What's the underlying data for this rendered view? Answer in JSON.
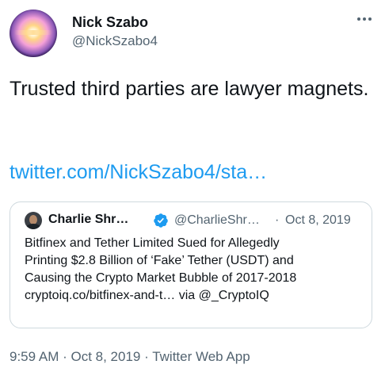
{
  "author": {
    "name": "Nick Szabo",
    "handle": "@NickSzabo4"
  },
  "tweet": {
    "text": "Trusted third parties are lawyer magnets.",
    "link": "twitter.com/NickSzabo4/sta…"
  },
  "quoted": {
    "name": "Charlie Shr…",
    "handle": "@CharlieShr…",
    "dot": "·",
    "date": "Oct 8, 2019",
    "lines": [
      "Bitfinex and Tether Limited Sued for Allegedly",
      "Printing $2.8 Billion of ‘Fake’ Tether (USDT) and",
      "Causing the Crypto Market Bubble of 2017-2018",
      "cryptoiq.co/bitfinex-and-t… via @_CryptoIQ"
    ]
  },
  "footer": {
    "time": "9:59 AM",
    "date": "Oct 8, 2019",
    "source": "Twitter Web App",
    "separator": " · "
  },
  "icons": {
    "more": "more-options-icon",
    "verified": "verified-badge-icon"
  },
  "colors": {
    "link": "#1d9bf0",
    "secondary_text": "#536471",
    "verified": "#1d9bf0"
  }
}
